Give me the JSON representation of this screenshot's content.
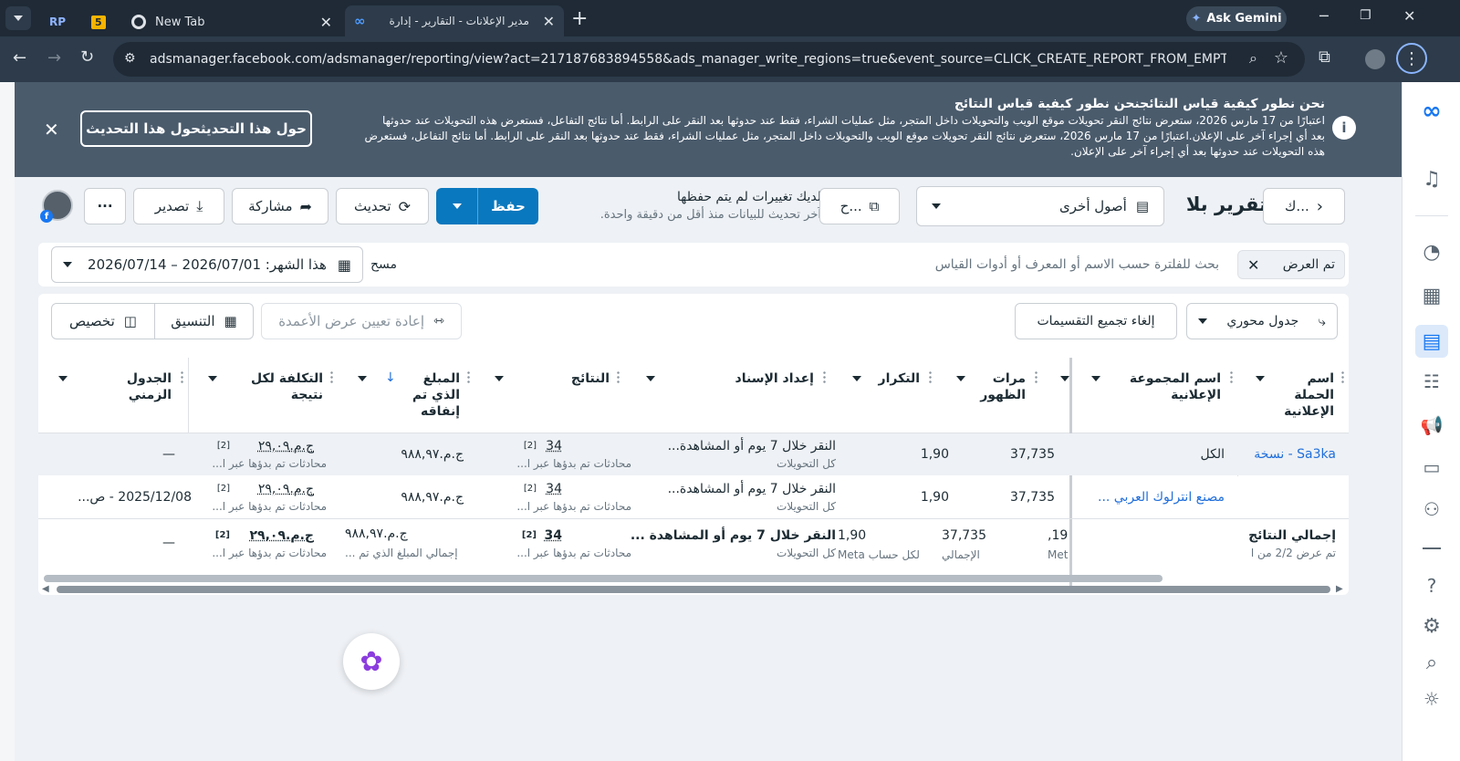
{
  "browser": {
    "tabs": [
      {
        "label": "RP"
      },
      {
        "label": "5"
      },
      {
        "label": "New Tab"
      },
      {
        "label": "مدير الإعلانات - التقارير - إدارة"
      }
    ],
    "gemini_label": "Ask Gemini",
    "url": "adsmanager.facebook.com/adsmanager/reporting/view?act=217187683894558&ads_manager_write_regions=true&event_source=CLICK_CREATE_REPORT_FROM_EMPTY_REPORT_MANA..."
  },
  "banner": {
    "title": "نحن نطور كيفية قياس النتائجنحن نطور كيفية قياس النتائج",
    "line1": "اعتبارًا من 17 مارس 2026، ستعرض نتائج النقر تحويلات موقع الويب والتحويلات داخل المتجر، مثل عمليات الشراء، فقط عند حدوثها بعد النقر على الرابط. أما نتائج التفاعل، فستعرض هذه التحويلات عند حدوثها",
    "line2": "بعد أي إجراء آخر على الإعلان.اعتبارًا من 17 مارس 2026، ستعرض نتائج النقر تحويلات موقع الويب والتحويلات داخل المتجر، مثل عمليات الشراء، فقط عند حدوثها بعد النقر على الرابط. أما نتائج التفاعل، فستعرض",
    "line3": "هذه التحويلات عند حدوثها بعد أي إجراء آخر على الإعلان.",
    "about_button": "حول هذا التحديثحول هذا التحديث"
  },
  "toolbar": {
    "back_label": "ك...",
    "report_title": "تقرير بلا",
    "assets_label": "أصول أخرى",
    "copy_label": "ح...",
    "unsaved_title": "لديك تغييرات لم يتم حفظها",
    "unsaved_sub": "آخر تحديث للبيانات منذ أقل من دقيقة واحدة.",
    "save_label": "حفظ",
    "refresh_label": "تحديث",
    "share_label": "مشاركة",
    "export_label": "تصدير",
    "more_label": "···"
  },
  "filter": {
    "chip_label": "تم العرض",
    "search_placeholder": "بحث للفلترة حسب الاسم أو المعرف أو أدوات القياس",
    "clear_label": "مسح",
    "date_label": "هذا الشهر: 2026/07/01 – 2026/07/14"
  },
  "table_toolbar": {
    "pivot_label": "جدول محوري",
    "ungroup_label": "إلغاء تجميع التقسيمات",
    "reset_widths_label": "إعادة تعيين عرض الأعمدة",
    "format_label": "التنسيق",
    "customize_label": "تخصيص"
  },
  "columns": {
    "campaign": "اسم الحملة الإعلانية",
    "adset": "اسم المجموعة الإعلانية",
    "impressions": "مرات الظهور",
    "frequency": "التكرار",
    "attribution": "إعداد الإسناد",
    "results": "النتائج",
    "spent": "المبلغ الذي تم إنفاقه",
    "cost_per_result": "التكلفة لكل نتيجة",
    "timeline": "الجدول الزمني"
  },
  "rows": [
    {
      "campaign": "Sa3ka - نسخة",
      "adset": "الكل",
      "impressions": "37,735",
      "frequency": "1,90",
      "attribution": "النقر خلال 7 يوم أو المشاهدة...",
      "attribution_sub": "كل التحويلات",
      "results": "34",
      "results_sub": "محادثات تم بدؤها عبر ا...",
      "spent": "ج.م.٩٨٨,٩٧",
      "cost": "ج.م.٢٩,٠٩",
      "cost_sub": "محادثات تم بدؤها عبر ا...",
      "timeline": "—"
    },
    {
      "campaign": "",
      "adset": "مصنع انترلوك العربي ...",
      "impressions": "37,735",
      "frequency": "1,90",
      "attribution": "النقر خلال 7 يوم أو المشاهدة...",
      "attribution_sub": "كل التحويلات",
      "results": "34",
      "results_sub": "محادثات تم بدؤها عبر ا...",
      "spent": "ج.م.٩٨٨,٩٧",
      "cost": "ج.م.٢٩,٠٩",
      "cost_sub": "محادثات تم بدؤها عبر ا...",
      "timeline": "2025/12/08 - ص..."
    }
  ],
  "totals": {
    "title": "إجمالي النتائج",
    "sub": "تم عرض 2/2 من ا",
    "reach": "19,",
    "reach_sub": "Met",
    "impressions": "37,735",
    "impressions_sub": "الإجمالي",
    "frequency": "1,90",
    "frequency_sub": "لكل حساب Meta",
    "attribution": "النقر خلال 7 يوم أو المشاهدة ...",
    "attribution_sub": "كل التحويلات",
    "results": "34",
    "results_sub": "محادثات تم بدؤها عبر ا...",
    "spent": "ج.م.٩٨٨,٩٧",
    "spent_sub": "إجمالي المبلغ الذي تم ...",
    "cost": "ج.م.٢٩,٠٩",
    "cost_sub": "محادثات تم بدؤها عبر ا...",
    "timeline": "—"
  },
  "footnote": "[2]",
  "colors": {
    "brand": "#1877f2",
    "primary": "#0a78be",
    "banner": "#4a5b6c"
  }
}
